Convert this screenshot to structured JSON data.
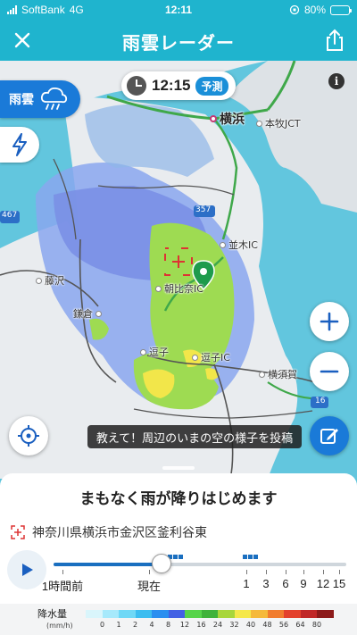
{
  "status_bar": {
    "carrier": "SoftBank",
    "network": "4G",
    "time": "12:11",
    "battery": "80%",
    "battery_level": 0.8
  },
  "header": {
    "title": "雨雲レーダー",
    "close_icon": "close-icon",
    "share_icon": "share-icon"
  },
  "map": {
    "time": "12:15",
    "time_badge": "予測",
    "layers": {
      "rain_label": "雨雲",
      "thunder_icon": "lightning-icon"
    },
    "labels": {
      "yokohama": "横浜",
      "honmoku_jct": "本牧JCT",
      "fujisawa": "藤沢",
      "kamakura": "鎌倉",
      "zushi": "逗子",
      "zushi_ic": "逗子IC",
      "yokosuka": "横須賀",
      "asahina_ic": "朝比奈IC",
      "namiki_ic": "並木IC",
      "road_16": "16",
      "road_357": "357",
      "road_467": "467"
    },
    "post_banner": "教えて！周辺のいまの空の様子を投稿",
    "colors": {
      "sea": "#62c6de",
      "land": "#e9ecef",
      "rain_light": "#7fa0ee",
      "rain_mid": "#9edb52",
      "rain_heavy": "#f2e64a",
      "accent": "#1a7ad8"
    }
  },
  "sheet": {
    "headline": "まもなく雨が降りはじめます",
    "location": "神奈川県横浜市金沢区釜利谷東",
    "timeline": {
      "progress": 0.37,
      "labels": [
        "1時間前",
        "現在",
        "1",
        "3",
        "6",
        "9",
        "12",
        "15"
      ]
    },
    "legend": {
      "title": "降水量",
      "unit": "(mm/h)",
      "values": [
        "0",
        "1",
        "2",
        "4",
        "8",
        "12",
        "16",
        "24",
        "32",
        "40",
        "48",
        "56",
        "64",
        "80"
      ],
      "colors": [
        "#d9f5fb",
        "#a6e9fb",
        "#6fd8f6",
        "#3cbdf0",
        "#2b8ff0",
        "#4361e4",
        "#56d44a",
        "#3fb23a",
        "#a8d63a",
        "#f5e84a",
        "#f5b93a",
        "#f17c2e",
        "#e3402c",
        "#c02727",
        "#8c1a1a"
      ]
    }
  }
}
